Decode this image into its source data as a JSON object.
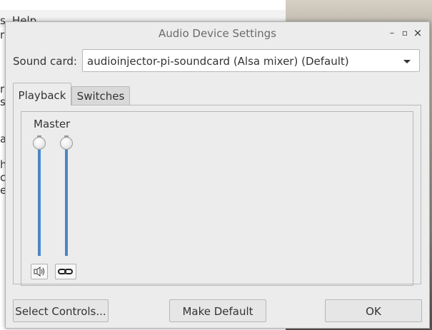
{
  "background_window": {
    "menu_items": [
      "s",
      "Help"
    ],
    "side_chars": [
      "r",
      "r",
      "s",
      "a",
      "h",
      "c",
      "e"
    ]
  },
  "dialog": {
    "title": "Audio Device Settings",
    "window_buttons": {
      "minimize": "–",
      "maximize": "▫",
      "close": "×"
    },
    "sound_card": {
      "label": "Sound card:",
      "value": "audioinjector-pi-soundcard (Alsa mixer) (Default)"
    },
    "tabs": [
      {
        "label": "Playback",
        "active": true
      },
      {
        "label": "Switches",
        "active": false
      }
    ],
    "channel": {
      "label": "Master",
      "sliders": [
        {
          "level": 1.0
        },
        {
          "level": 1.0
        }
      ],
      "mute_icon": "speaker-icon",
      "link_icon": "chain-link-icon"
    },
    "buttons": {
      "select_controls": "Select Controls...",
      "make_default": "Make Default",
      "ok": "OK"
    },
    "colors": {
      "slider_track": "#4a86c8",
      "dialog_bg": "#ececec"
    }
  }
}
